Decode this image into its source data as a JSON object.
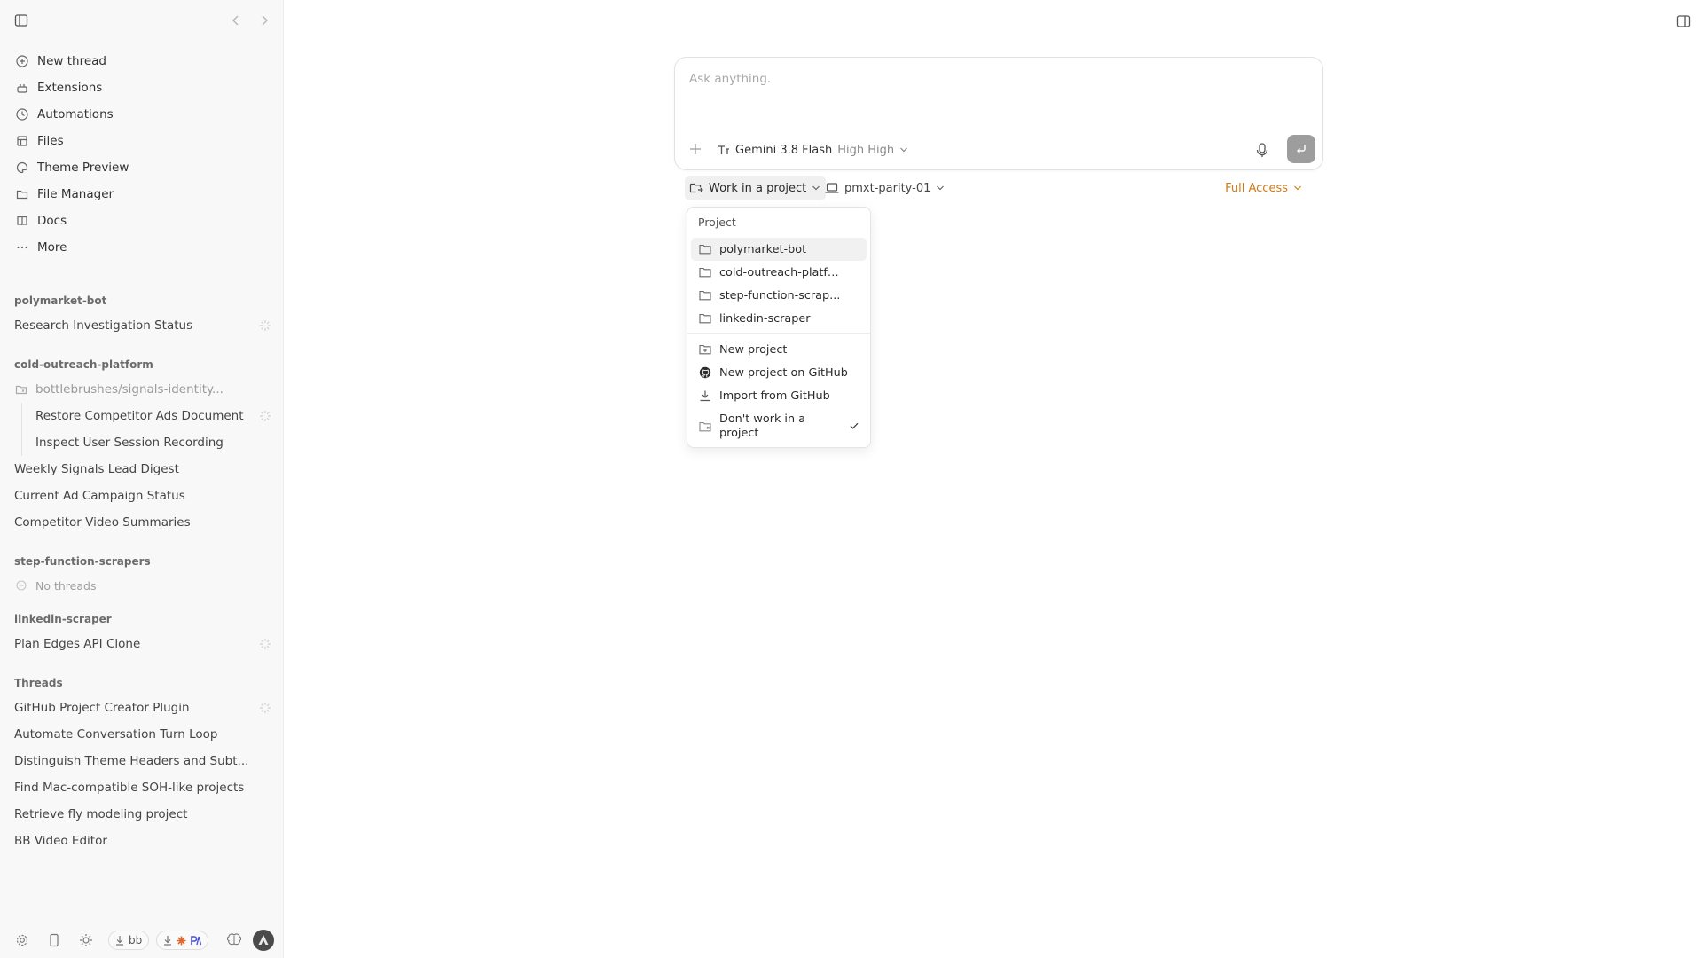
{
  "sidebar": {
    "nav": [
      {
        "label": "New thread",
        "icon": "plus-circle-icon"
      },
      {
        "label": "Extensions",
        "icon": "plug-icon"
      },
      {
        "label": "Automations",
        "icon": "clock-icon"
      },
      {
        "label": "Files",
        "icon": "files-icon"
      },
      {
        "label": "Theme Preview",
        "icon": "palette-icon"
      },
      {
        "label": "File Manager",
        "icon": "folder-icon"
      },
      {
        "label": "Docs",
        "icon": "book-icon"
      },
      {
        "label": "More",
        "icon": "ellipsis-icon"
      }
    ],
    "groups": {
      "polymarket": {
        "title": "polymarket-bot",
        "threads": [
          "Research Investigation Status"
        ]
      },
      "cold": {
        "title": "cold-outreach-platform",
        "branch": "bottlebrushes/signals-identity...",
        "sub_threads": [
          "Restore Competitor Ads Document",
          "Inspect User Session Recording"
        ],
        "threads": [
          "Weekly Signals Lead Digest",
          "Current Ad Campaign Status",
          "Competitor Video Summaries"
        ]
      },
      "step": {
        "title": "step-function-scrapers",
        "empty": "No threads"
      },
      "linkedin": {
        "title": "linkedin-scraper",
        "threads": [
          "Plan Edges API Clone"
        ]
      },
      "threads": {
        "title": "Threads",
        "items": [
          "GitHub Project Creator Plugin",
          "Automate Conversation Turn Loop",
          "Distinguish Theme Headers and Subt...",
          "Find Mac-compatible SOH-like projects",
          "Retrieve fly modeling project",
          "BB Video Editor"
        ]
      }
    },
    "footer": {
      "pill1_label": "bb",
      "icons": [
        "settings-icon",
        "phone-icon",
        "sun-icon",
        "download-icon"
      ]
    }
  },
  "composer": {
    "placeholder": "Ask anything.",
    "model": "Gemini 3.8 Flash",
    "effort": "High High"
  },
  "controls": {
    "project_button": "Work in a project",
    "branch": "pmxt-parity-01",
    "access": "Full Access",
    "access_color": "#d07a16"
  },
  "project_menu": {
    "header": "Project",
    "projects": [
      "polymarket-bot",
      "cold-outreach-platfo...",
      "step-function-scrap...",
      "linkedin-scraper"
    ],
    "actions": [
      "New project",
      "New project on GitHub",
      "Import from GitHub",
      "Don't work in a project"
    ],
    "selected_action": "Don't work in a project"
  }
}
